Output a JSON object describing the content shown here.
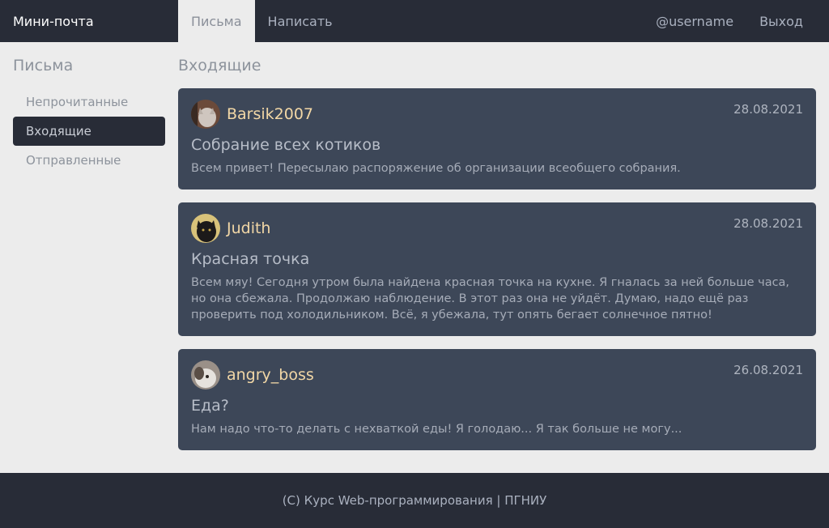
{
  "navbar": {
    "brand": "Мини-почта",
    "links": [
      {
        "label": "Письма"
      },
      {
        "label": "Написать"
      }
    ],
    "username": "@username",
    "logout": "Выход"
  },
  "sidebar": {
    "title": "Письма",
    "items": [
      {
        "label": "Непрочитанные"
      },
      {
        "label": "Входящие"
      },
      {
        "label": "Отправленные"
      }
    ]
  },
  "main": {
    "title": "Входящие",
    "messages": [
      {
        "sender": "Barsik2007",
        "date": "28.08.2021",
        "subject": "Собрание всех котиков",
        "body": "Всем привет! Пересылаю распоряжение об организации всеобщего собрания."
      },
      {
        "sender": "Judith",
        "date": "28.08.2021",
        "subject": "Красная точка",
        "body": "Всем мяу! Сегодня утром была найдена красная точка на кухне. Я гналась за ней больше часа, но она сбежала. Продолжаю наблюдение. В этот раз она не уйдёт. Думаю, надо ещё раз проверить под холодильником. Всё, я убежала, тут опять бегает солнечное пятно!"
      },
      {
        "sender": "angry_boss",
        "date": "26.08.2021",
        "subject": "Еда?",
        "body": "Нам надо что-то делать с нехваткой еды! Я голодаю... Я так больше не могу..."
      }
    ]
  },
  "footer": {
    "text": "(C) Курс Web-программирования | ПГНИУ"
  }
}
